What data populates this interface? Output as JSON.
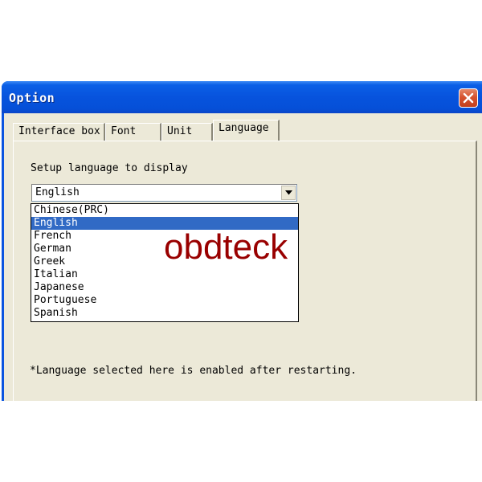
{
  "window": {
    "title": "Option",
    "close_icon": "close-icon"
  },
  "tabs": [
    {
      "label": "Interface box",
      "active": false
    },
    {
      "label": "Font",
      "active": false
    },
    {
      "label": "Unit",
      "active": false
    },
    {
      "label": "Language",
      "active": true
    }
  ],
  "language_page": {
    "setup_label": "Setup language to display",
    "combo_value": "English",
    "combo_arrow_icon": "dropdown-arrow-icon",
    "options": [
      {
        "label": "Chinese(PRC)",
        "selected": false
      },
      {
        "label": "English",
        "selected": true
      },
      {
        "label": "French",
        "selected": false
      },
      {
        "label": "German",
        "selected": false
      },
      {
        "label": "Greek",
        "selected": false
      },
      {
        "label": "Italian",
        "selected": false
      },
      {
        "label": "Japanese",
        "selected": false
      },
      {
        "label": "Portuguese",
        "selected": false
      },
      {
        "label": "Spanish",
        "selected": false
      }
    ],
    "note": "*Language selected here is enabled after restarting."
  },
  "watermark": "obdteck",
  "colors": {
    "titlebar": "#0753dd",
    "client_bg": "#ece9d8",
    "selection": "#316ac5",
    "close_button": "#d6532f",
    "watermark": "#990000"
  }
}
